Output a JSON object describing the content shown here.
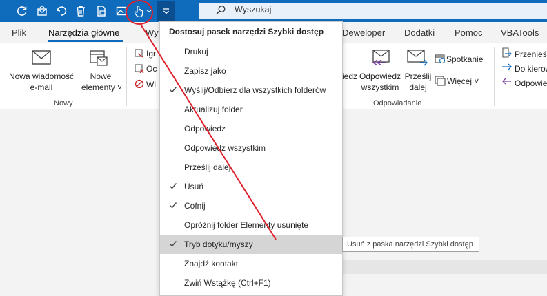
{
  "search": {
    "placeholder": "Wyszukaj"
  },
  "tabs": [
    {
      "label": "Plik"
    },
    {
      "label": "Narzędzia główne"
    },
    {
      "label": "Wys"
    },
    {
      "label": "Deweloper"
    },
    {
      "label": "Dodatki"
    },
    {
      "label": "Pomoc"
    },
    {
      "label": "VBATools"
    }
  ],
  "ribbon": {
    "new_email": {
      "line1": "Nowa wiadomość",
      "line2": "e-mail"
    },
    "new_items": {
      "line1": "Nowe",
      "line2": "elementy"
    },
    "group_new": "Nowy",
    "ignore_partial": "Igr",
    "cleanup_partial": "Oc",
    "junk_partial": "Wi",
    "reply_partial": "iedz",
    "reply_all": {
      "line1": "Odpowiedz",
      "line2": "wszystkim"
    },
    "forward": {
      "line1": "Prześlij",
      "line2": "dalej"
    },
    "meeting": "Spotkanie",
    "more": "Więcej",
    "group_respond": "Odpowiadanie",
    "move_to": "Przenieś",
    "to_manager": "Do kierow",
    "reply_delete": "Odpowie"
  },
  "menu": {
    "title": "Dostosuj pasek narzędzi Szybki dostęp",
    "items": [
      {
        "label": "Drukuj",
        "checked": false
      },
      {
        "label": "Zapisz jako",
        "checked": false
      },
      {
        "label": "Wyślij/Odbierz dla wszystkich folderów",
        "checked": true
      },
      {
        "label": "Aktualizuj folder",
        "checked": false
      },
      {
        "label": "Odpowiedz",
        "checked": false
      },
      {
        "label": "Odpowiedz wszystkim",
        "checked": false
      },
      {
        "label": "Prześlij dalej",
        "checked": false
      },
      {
        "label": "Usuń",
        "checked": true
      },
      {
        "label": "Cofnij",
        "checked": true
      },
      {
        "label": "Opróżnij folder Elementy usunięte",
        "checked": false
      },
      {
        "label": "Tryb dotyku/myszy",
        "checked": true,
        "highlighted": true
      },
      {
        "label": "Znajdź kontakt",
        "checked": false
      },
      {
        "label": "Zwiń Wstążkę (Ctrl+F1)",
        "checked": false
      }
    ]
  },
  "tooltip": "Usuń z paska narzędzi Szybki dostęp",
  "colors": {
    "titlebar": "#0f6cbd",
    "annotation": "#e0202a",
    "highlight": "#d5d5d5",
    "reply_accent": "#7b3fa0"
  },
  "icons": [
    "sync-icon",
    "send-receive-icon",
    "undo-icon",
    "delete-icon",
    "save-as-icon",
    "picture-icon",
    "touch-mode-icon",
    "chevron-down-icon",
    "search-icon",
    "mail-icon",
    "calendar-icon",
    "checkmark-icon"
  ]
}
